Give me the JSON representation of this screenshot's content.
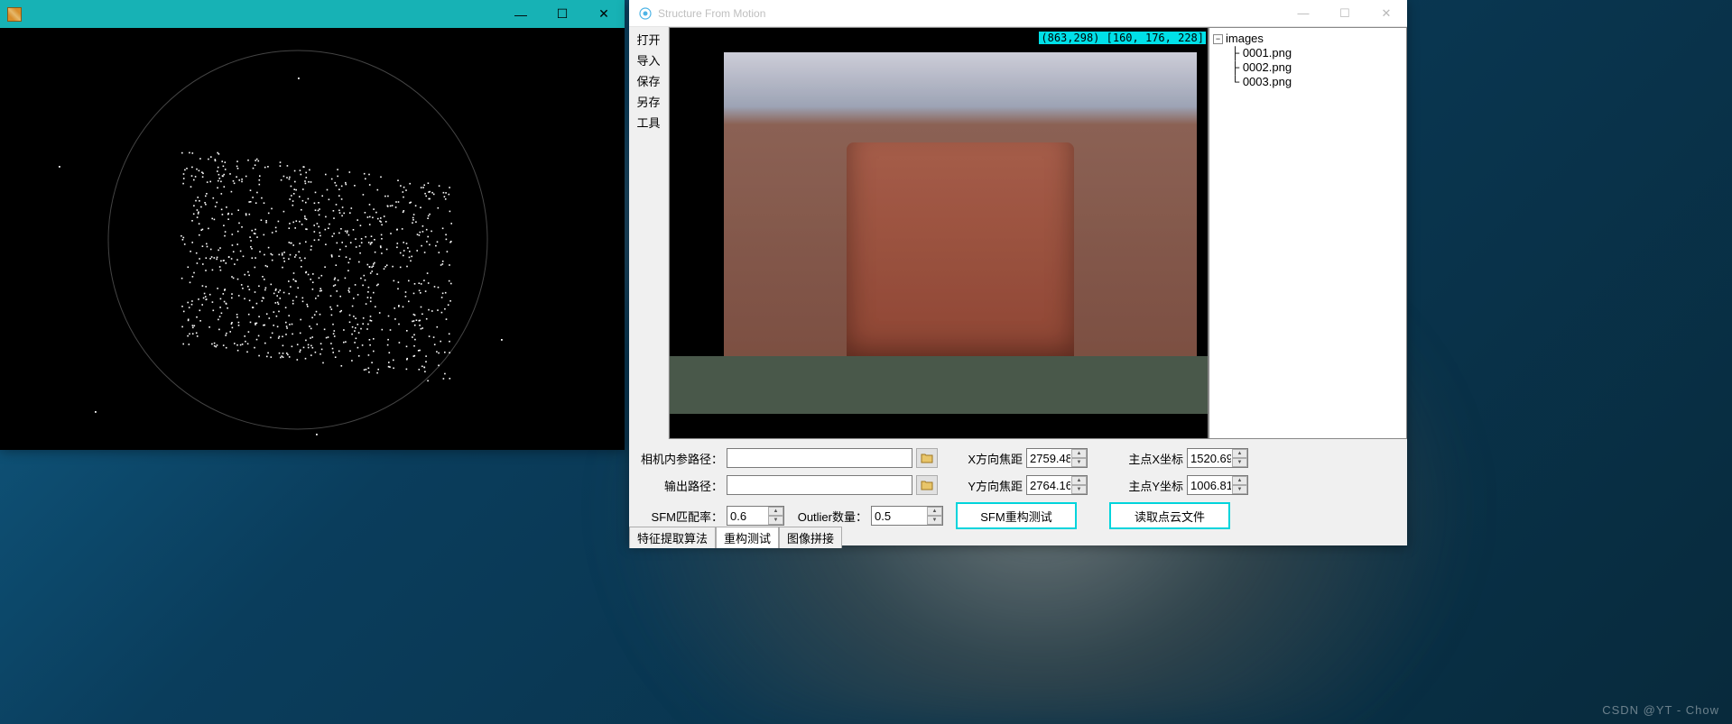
{
  "left_window": {
    "controls": {
      "min": "—",
      "max": "☐",
      "close": "✕"
    }
  },
  "right_window": {
    "title": "Structure From Motion",
    "controls": {
      "min": "—",
      "max": "☐",
      "close": "✕"
    },
    "side_menu": [
      "打开",
      "导入",
      "保存",
      "另存",
      "工具"
    ],
    "coord_badge": "(863,298) [160, 176, 228]",
    "tree": {
      "root": "images",
      "children": [
        "0001.png",
        "0002.png",
        "0003.png"
      ]
    },
    "params": {
      "camera_path_label": "相机内参路径：",
      "camera_path_value": "",
      "output_path_label": "输出路径：",
      "output_path_value": "",
      "focal_x_label": "X方向焦距",
      "focal_x_value": "2759.48",
      "focal_y_label": "Y方向焦距",
      "focal_y_value": "2764.16",
      "principal_x_label": "主点X坐标",
      "principal_x_value": "1520.69",
      "principal_y_label": "主点Y坐标",
      "principal_y_value": "1006.81",
      "sfm_match_label": "SFM匹配率：",
      "sfm_match_value": "0.6",
      "outlier_label": "Outlier数量：",
      "outlier_value": "0.5",
      "sfm_rebuild_btn": "SFM重构测试",
      "load_pc_btn": "读取点云文件"
    },
    "tabs": [
      "特征提取算法",
      "重构测试",
      "图像拼接"
    ],
    "active_tab": 1
  },
  "watermark": "CSDN @YT - Chow"
}
